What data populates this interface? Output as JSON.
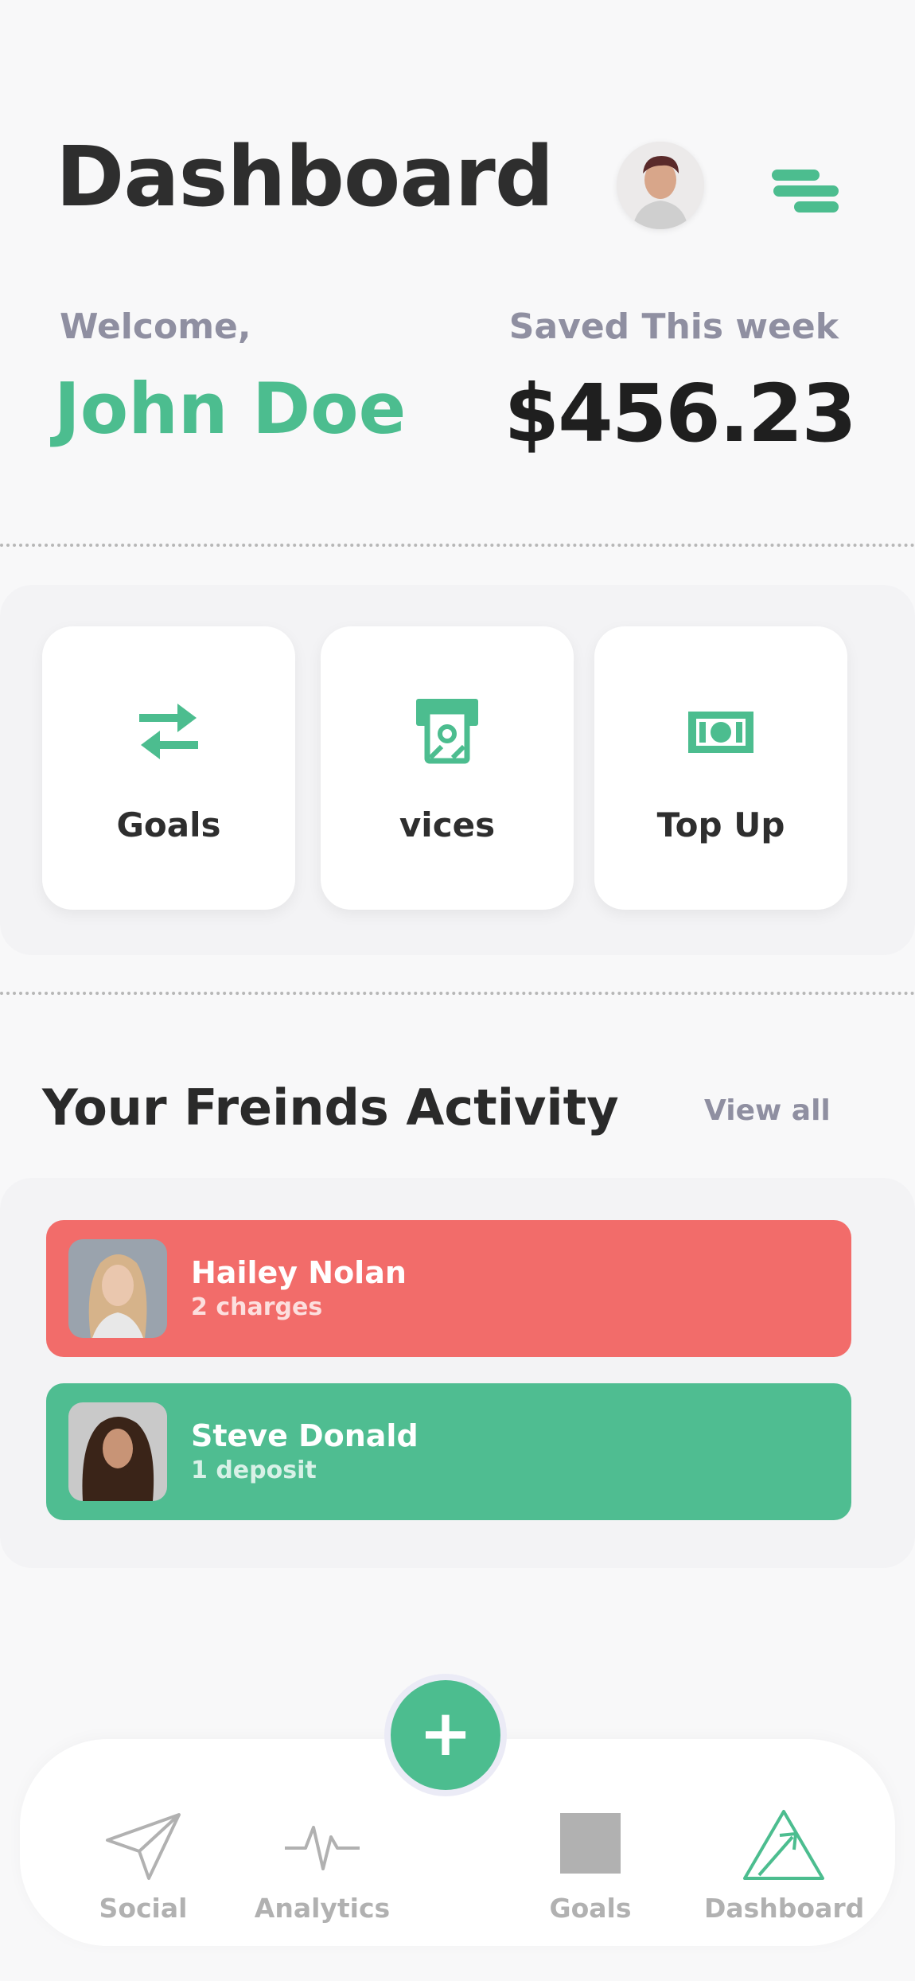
{
  "header": {
    "title": "Dashboard",
    "avatar_icon": "user-avatar",
    "menu_icon": "menu-icon"
  },
  "summary": {
    "welcome_label": "Welcome,",
    "user_name": "John Doe",
    "saved_label": "Saved This week",
    "saved_amount": "$456.23"
  },
  "actions": [
    {
      "label": "Goals",
      "icon": "transfer-arrows-icon"
    },
    {
      "label": "vices",
      "icon": "atm-cash-icon"
    },
    {
      "label": "Top Up",
      "icon": "banknote-icon"
    }
  ],
  "activity": {
    "title": "Your Freinds Activity",
    "view_all": "View all",
    "items": [
      {
        "name": "Hailey Nolan",
        "detail": "2 charges",
        "color": "#f26c6a"
      },
      {
        "name": "Steve Donald",
        "detail": "1 deposit",
        "color": "#4fbd91"
      }
    ]
  },
  "fab": {
    "label": "+",
    "icon": "plus-icon"
  },
  "bottom_nav": [
    {
      "label": "Social",
      "icon": "paper-plane-icon",
      "active": false
    },
    {
      "label": "Analytics",
      "icon": "pulse-icon",
      "active": false
    },
    {
      "label": "Goals",
      "icon": "square-icon",
      "active": false
    },
    {
      "label": "Dashboard",
      "icon": "dashboard-triangle-icon",
      "active": true
    }
  ],
  "colors": {
    "accent": "#4cbd8f",
    "negative": "#f26c6a",
    "text_dark": "#2e2e2e",
    "text_muted": "#8f8fa1",
    "background": "#f8f8f9"
  }
}
